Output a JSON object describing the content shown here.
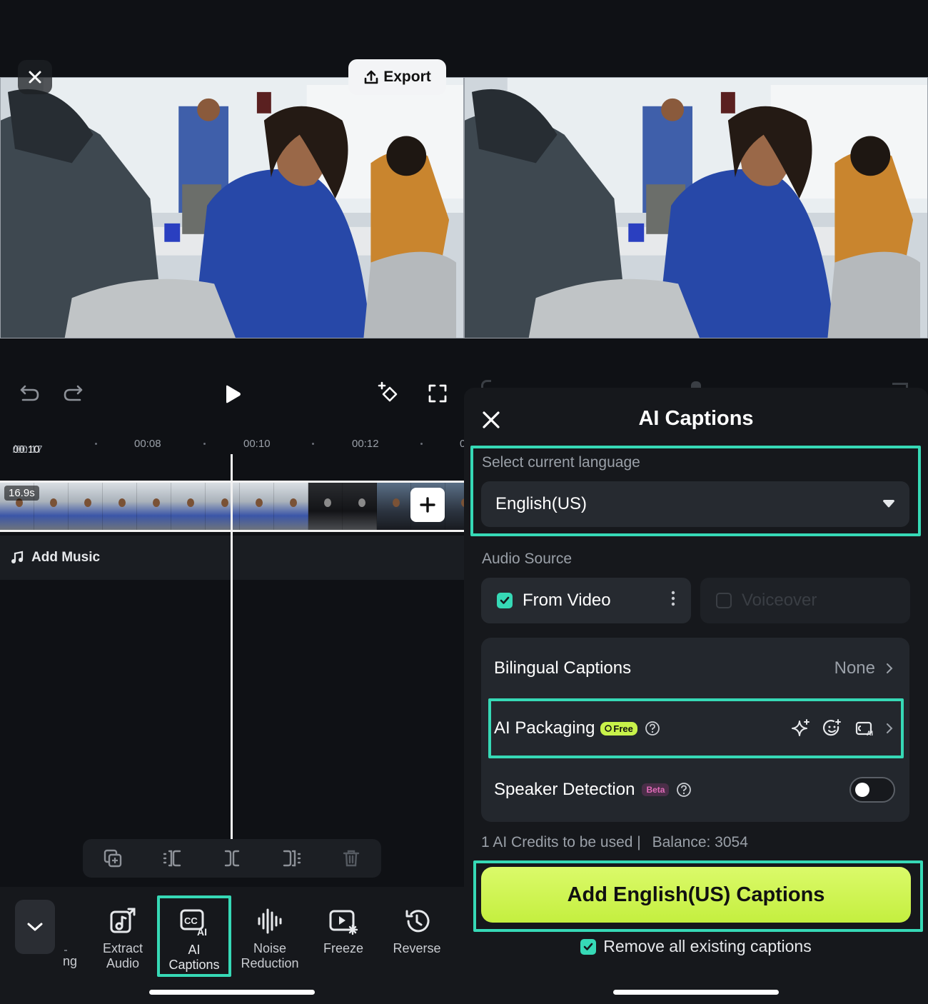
{
  "editor": {
    "export_label": "Export",
    "ruler": {
      "current": "00:10",
      "total": "/00:17",
      "t1": "00:08",
      "t2": "00:10",
      "t3": "00:12",
      "t4": "0"
    },
    "clip_duration": "16.9s",
    "add_music_label": "Add Music",
    "toolbar": {
      "partial_label": "ng",
      "items": [
        {
          "label_line1": "Extract",
          "label_line2": "Audio"
        },
        {
          "label_line1": "AI",
          "label_line2": "Captions"
        },
        {
          "label_line1": "Noise",
          "label_line2": "Reduction"
        },
        {
          "label_line1": "Freeze",
          "label_line2": ""
        },
        {
          "label_line1": "Reverse",
          "label_line2": ""
        }
      ]
    }
  },
  "captions_panel": {
    "title": "AI Captions",
    "language_section_label": "Select current language",
    "selected_language": "English(US)",
    "audio_source_label": "Audio Source",
    "audio_sources": [
      {
        "label": "From Video",
        "checked": true
      },
      {
        "label": "Voiceover",
        "checked": false
      }
    ],
    "bilingual_label": "Bilingual Captions",
    "bilingual_value": "None",
    "ai_packaging_label": "AI Packaging",
    "free_badge": "Free",
    "speaker_detection_label": "Speaker Detection",
    "beta_badge": "Beta",
    "credits_text": "1 AI Credits to be used |",
    "balance_text": "Balance: 3054",
    "cta_label": "Add English(US) Captions",
    "remove_existing_label": "Remove all existing captions"
  },
  "colors": {
    "accent_teal": "#36d9b6",
    "cta_lime": "#c4ef3f",
    "background": "#0f1115"
  }
}
